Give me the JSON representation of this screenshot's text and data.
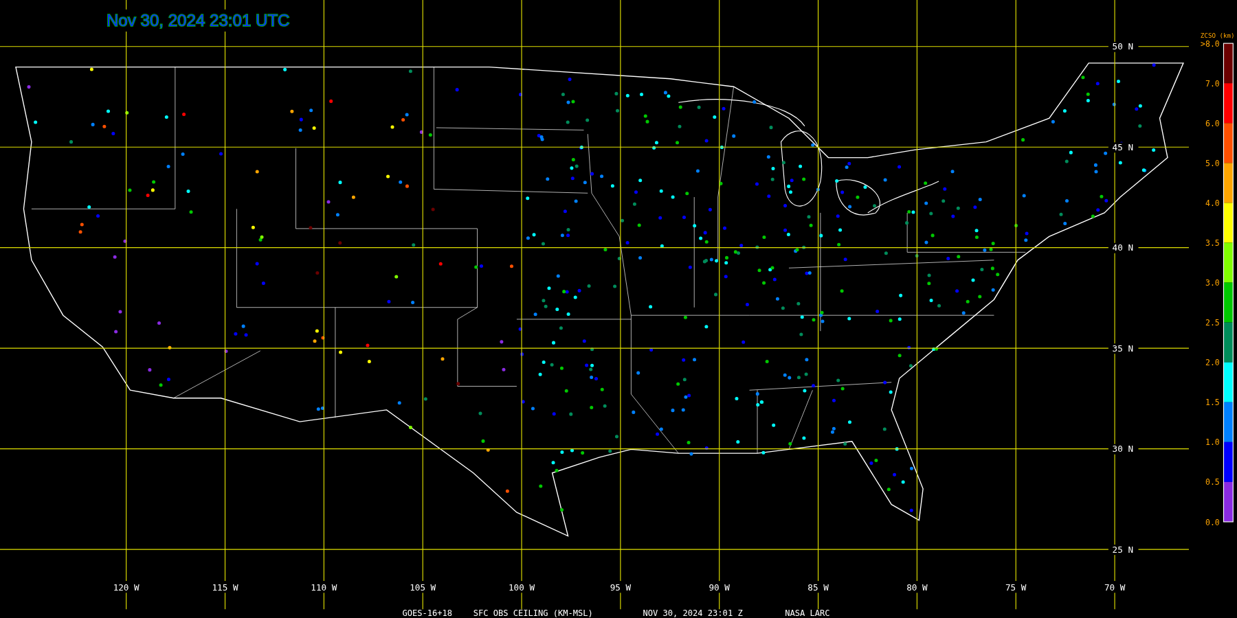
{
  "title": "Nov 30, 2024 23:01 UTC",
  "longitude_labels": [
    "120 W",
    "115 W",
    "110 W",
    "105 W",
    "100 W",
    "95 W",
    "90 W",
    "85 W",
    "80 W",
    "75 W",
    "70 W"
  ],
  "latitude_labels": [
    "50 N",
    "45 N",
    "40 N",
    "35 N",
    "30 N",
    "25 N"
  ],
  "legend": {
    "title": "ZCSO (km)",
    "labels": [
      ">8.0",
      "7.0",
      "6.0",
      "5.0",
      "4.0",
      "3.5",
      "3.0",
      "2.5",
      "2.0",
      "1.5",
      "1.0",
      "0.5",
      "0.0"
    ],
    "bins": [
      {
        "color": "#6b0000"
      },
      {
        "color": "#ff0000"
      },
      {
        "color": "#ff5000"
      },
      {
        "color": "#ffa500"
      },
      {
        "color": "#ffff00"
      },
      {
        "color": "#80ff00"
      },
      {
        "color": "#00c800"
      },
      {
        "color": "#008c5a"
      },
      {
        "color": "#00ffff"
      },
      {
        "color": "#0080ff"
      },
      {
        "color": "#0000ff"
      },
      {
        "color": "#8a2be2"
      }
    ]
  },
  "footer": [
    "GOES-16+18",
    "SFC OBS CEILING (KM-MSL)",
    "NOV 30, 2024 23:01 Z",
    "NASA LARC"
  ]
}
